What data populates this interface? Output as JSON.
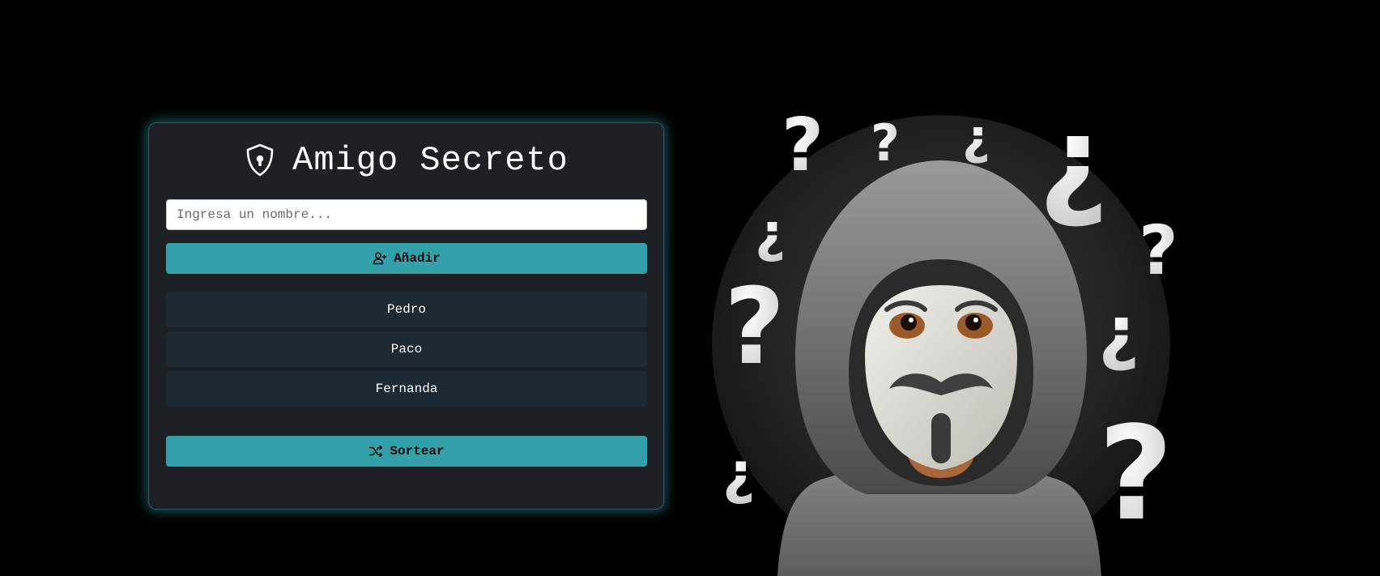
{
  "app": {
    "title": "Amigo Secreto",
    "title_icon": "shield-keyhole-icon"
  },
  "input": {
    "placeholder": "Ingresa un nombre...",
    "value": ""
  },
  "buttons": {
    "add": {
      "label": "Añadir",
      "icon": "add-user-icon"
    },
    "draw": {
      "label": "Sortear",
      "icon": "shuffle-icon"
    }
  },
  "names": [
    "Pedro",
    "Paco",
    "Fernanda"
  ],
  "illustration": {
    "subject": "hooded-masked-figure-with-question-marks"
  },
  "colors": {
    "background": "#000000",
    "card": "#1d2025",
    "accent": "#33a0aa",
    "list_item": "#1d2a34",
    "glow": "#37aab4"
  }
}
